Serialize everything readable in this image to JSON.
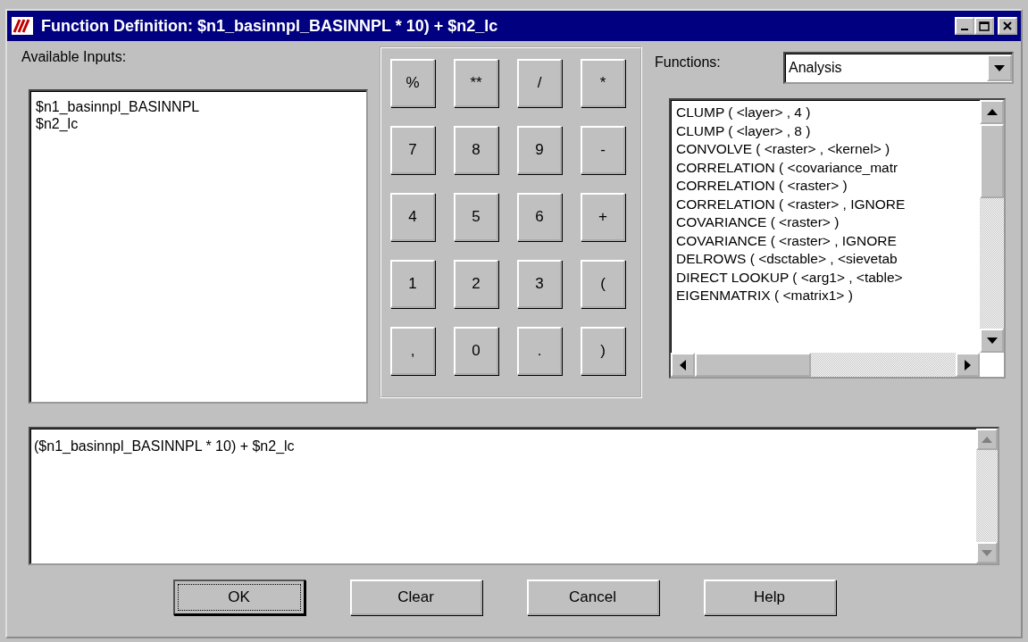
{
  "window": {
    "title": "Function Definition:  $n1_basinnpl_BASINNPL * 10) + $n2_lc"
  },
  "inputs": {
    "label": "Available Inputs:",
    "items": [
      {
        "text": "$n1_basinnpl_BASINNPL",
        "selected": false
      },
      {
        "text": "$n2_lc",
        "selected": false
      }
    ]
  },
  "keypad": [
    "%",
    "**",
    "/",
    "*",
    "7",
    "8",
    "9",
    "-",
    "4",
    "5",
    "6",
    "+",
    "1",
    "2",
    "3",
    "(",
    ",",
    "0",
    ".",
    ")"
  ],
  "functions": {
    "label": "Functions:",
    "category": "Analysis",
    "items": [
      {
        "text": "CLUMP ( <layer> , 4 )",
        "selected": false
      },
      {
        "text": "CLUMP ( <layer> , 8 )",
        "selected": false
      },
      {
        "text": "CONVOLVE ( <raster> , <kernel> )",
        "selected": false
      },
      {
        "text": "CORRELATION ( <covariance_matr",
        "selected": false
      },
      {
        "text": "CORRELATION ( <raster> )",
        "selected": false
      },
      {
        "text": "CORRELATION ( <raster> , IGNORE",
        "selected": false
      },
      {
        "text": "COVARIANCE ( <raster> )",
        "selected": false
      },
      {
        "text": "COVARIANCE ( <raster> , IGNORE",
        "selected": false
      },
      {
        "text": "DELROWS ( <dsctable> , <sievetab",
        "selected": false
      },
      {
        "text": "DIRECT LOOKUP ( <arg1> , <table>",
        "selected": false
      },
      {
        "text": "EIGENMATRIX ( <matrix1> )",
        "selected": false
      }
    ]
  },
  "expression": {
    "value": "($n1_basinnpl_BASINNPL * 10) + $n2_lc"
  },
  "buttons": [
    {
      "label": "OK",
      "focused": true
    },
    {
      "label": "Clear",
      "focused": false
    },
    {
      "label": "Cancel",
      "focused": false
    },
    {
      "label": "Help",
      "focused": false
    }
  ]
}
